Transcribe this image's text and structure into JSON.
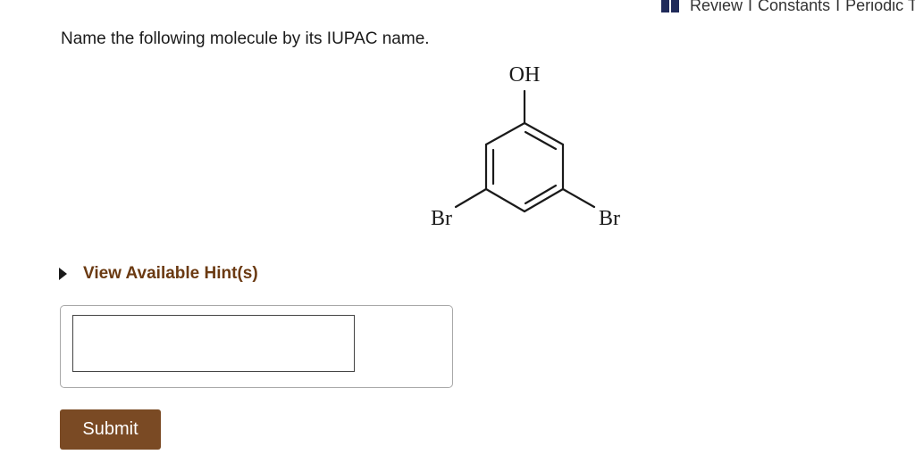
{
  "toolbar": {
    "icon": "book-icon",
    "review_label": "Review",
    "separator": "I",
    "constants_label": "Constants",
    "periodic_label": "Periodic Table"
  },
  "question": {
    "prompt": "Name the following molecule by its IUPAC name."
  },
  "molecule": {
    "labels": {
      "top": "OH",
      "left": "Br",
      "right": "Br"
    }
  },
  "hints": {
    "label": "View Available Hint(s)"
  },
  "answer": {
    "value": "",
    "placeholder": ""
  },
  "submit": {
    "label": "Submit"
  },
  "colors": {
    "accent_brown": "#7a4a24",
    "hint_text": "#6b3a12",
    "icon_navy": "#1f2a5a"
  }
}
